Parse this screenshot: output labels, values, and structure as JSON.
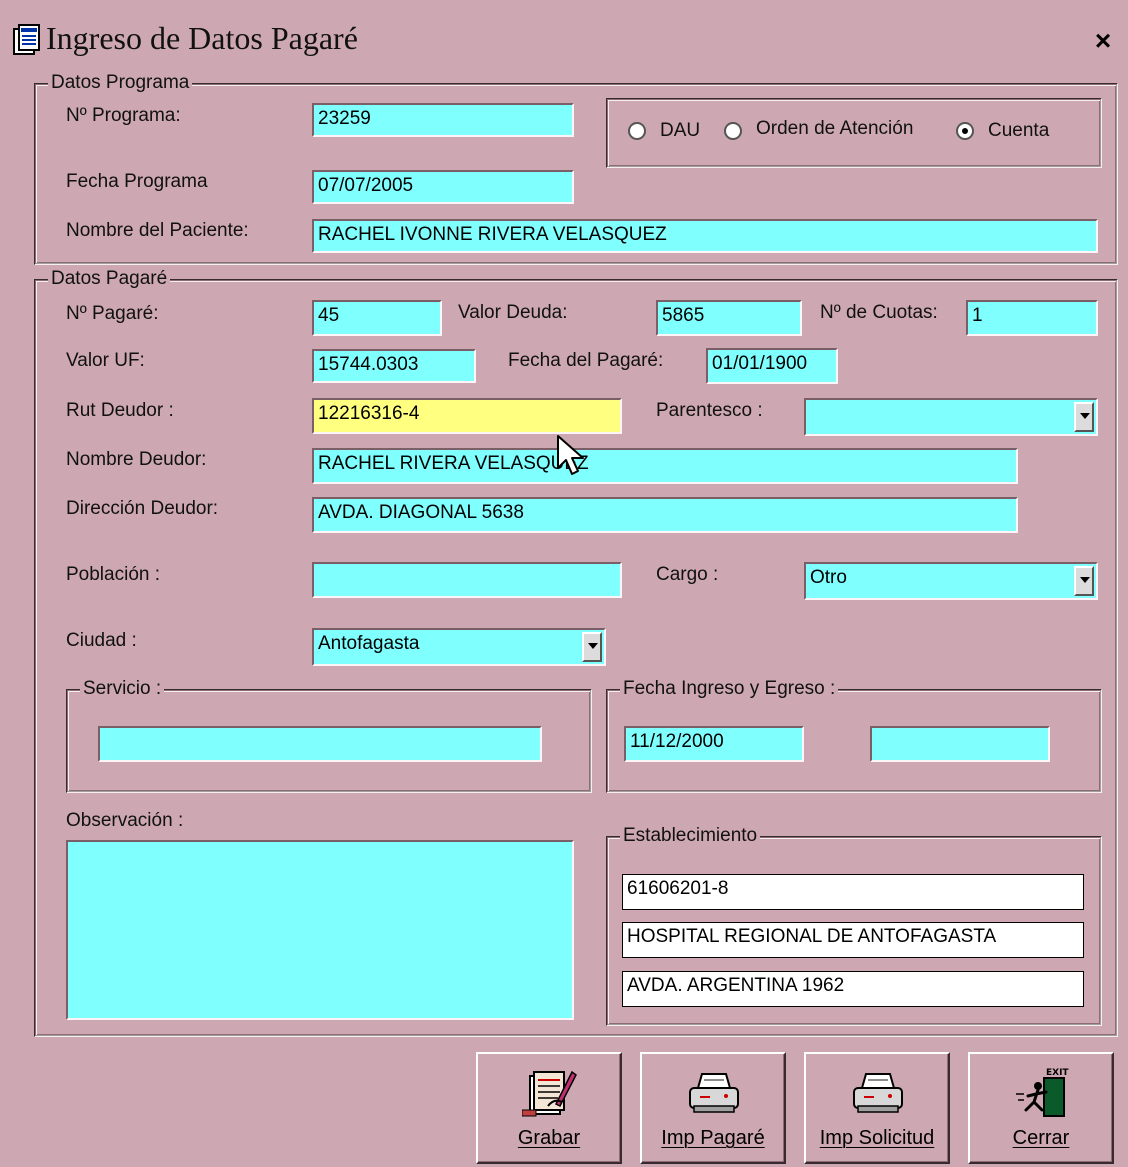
{
  "window": {
    "title": "Ingreso de Datos Pagaré",
    "close_label": "×"
  },
  "programa": {
    "legend": "Datos Programa",
    "numero_label": "Nº Programa:",
    "numero_value": "23259",
    "fecha_label": "Fecha Programa",
    "fecha_value": "07/07/2005",
    "paciente_label": "Nombre del Paciente:",
    "paciente_value": "RACHEL IVONNE RIVERA VELASQUEZ",
    "radios": [
      {
        "label": "DAU",
        "selected": false
      },
      {
        "label": "Orden de Atención",
        "selected": false
      },
      {
        "label": "Cuenta",
        "selected": true
      }
    ]
  },
  "pagare": {
    "legend": "Datos Pagaré",
    "numero_label": "Nº Pagaré:",
    "numero_value": "45",
    "deuda_label": "Valor Deuda:",
    "deuda_value": "5865",
    "cuotas_label": "Nº de  Cuotas:",
    "cuotas_value": "1",
    "uf_label": "Valor UF:",
    "uf_value": "15744.0303",
    "fecha_label": "Fecha del Pagaré:",
    "fecha_value": "01/01/1900",
    "rut_label": "Rut Deudor :",
    "rut_value": "12216316-4",
    "parentesco_label": "Parentesco :",
    "parentesco_value": "",
    "nombre_label": "Nombre  Deudor:",
    "nombre_value": "RACHEL RIVERA VELASQUEZ",
    "direccion_label": "Dirección Deudor:",
    "direccion_value": "AVDA. DIAGONAL 5638",
    "poblacion_label": "Población :",
    "poblacion_value": "",
    "cargo_label": "Cargo :",
    "cargo_value": "Otro",
    "ciudad_label": "Ciudad :",
    "ciudad_value": "Antofagasta",
    "servicio_legend": "Servicio :",
    "servicio_value": "",
    "fechas_legend": "Fecha Ingreso y Egreso :",
    "ingreso_value": "11/12/2000",
    "egreso_value": "",
    "observacion_label": "Observación :",
    "observacion_value": "",
    "establecimiento_legend": "Establecimiento",
    "est_rut": "61606201-8",
    "est_nombre": "HOSPITAL REGIONAL DE ANTOFAGASTA",
    "est_direccion": "AVDA. ARGENTINA 1962"
  },
  "buttons": {
    "grabar": "Grabar",
    "imp_pagare": "Imp Pagaré",
    "imp_solicitud": "Imp Solicitud",
    "cerrar": "Cerrar",
    "exit_text": "EXIT"
  },
  "colors": {
    "background": "#cda8b2",
    "field": "#80ffff",
    "field_active": "#ffff80"
  }
}
